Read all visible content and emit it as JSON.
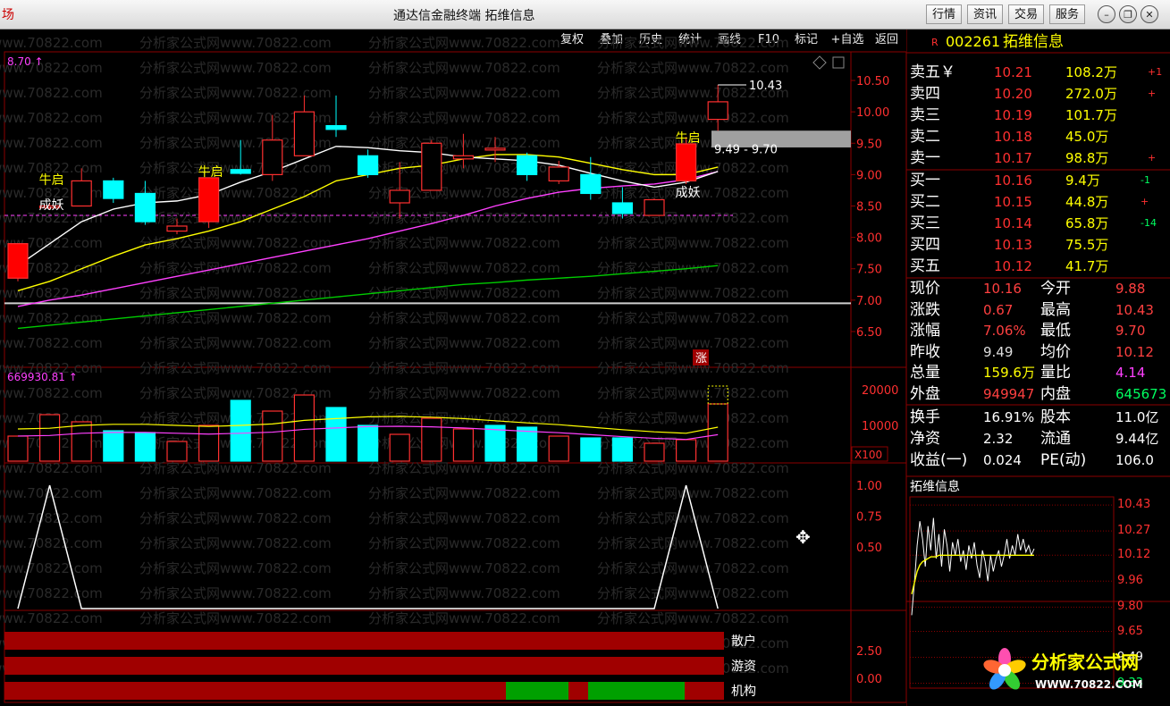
{
  "window": {
    "title": "通达信金融终端  拓维信息",
    "left_tag": "场",
    "top_buttons": [
      "行情",
      "资讯",
      "交易",
      "服务"
    ],
    "window_controls": [
      "minimize-icon",
      "restore-icon",
      "close-icon"
    ]
  },
  "toolbar": {
    "items": [
      "复权",
      "叠加",
      "历史",
      "统计",
      "画线",
      "F10",
      "标记",
      "+自选",
      "返回"
    ]
  },
  "watermark": "分析家公式网www.70822.com",
  "main_chart": {
    "indicator_label": "8.70",
    "price_axis": [
      "10.50",
      "10.00",
      "9.50",
      "9.00",
      "8.50",
      "8.00",
      "7.50",
      "7.00",
      "6.50"
    ],
    "high_label": "10.43",
    "range_label": "9.49 - 9.70",
    "signal_labels": [
      {
        "text": "牛启",
        "color": "#ffff00"
      },
      {
        "text": "成妖",
        "color": "#ffffff"
      },
      {
        "text": "牛启",
        "color": "#ffff00"
      },
      {
        "text": "牛启",
        "color": "#ffff00"
      },
      {
        "text": "成妖",
        "color": "#ffffff"
      }
    ],
    "zhang_tag": "涨",
    "candles": [
      {
        "o": 7.35,
        "c": 7.9,
        "h": 7.9,
        "l": 7.3
      },
      {
        "o": 8.5,
        "c": 8.5,
        "h": 8.55,
        "l": 8.45
      },
      {
        "o": 8.5,
        "c": 8.9,
        "h": 9.1,
        "l": 8.5
      },
      {
        "o": 8.9,
        "c": 8.62,
        "h": 8.95,
        "l": 8.55
      },
      {
        "o": 8.7,
        "c": 8.25,
        "h": 8.9,
        "l": 8.2
      },
      {
        "o": 8.1,
        "c": 8.18,
        "h": 8.3,
        "l": 8.05
      },
      {
        "o": 8.25,
        "c": 8.95,
        "h": 8.95,
        "l": 8.15
      },
      {
        "o": 9.08,
        "c": 9.02,
        "h": 9.55,
        "l": 9.0
      },
      {
        "o": 9.0,
        "c": 9.55,
        "h": 9.95,
        "l": 8.9
      },
      {
        "o": 9.3,
        "c": 10.0,
        "h": 10.26,
        "l": 9.3
      },
      {
        "o": 9.78,
        "c": 9.72,
        "h": 10.26,
        "l": 9.6
      },
      {
        "o": 9.3,
        "c": 9.0,
        "h": 9.4,
        "l": 8.95
      },
      {
        "o": 8.55,
        "c": 8.75,
        "h": 9.2,
        "l": 8.3
      },
      {
        "o": 8.75,
        "c": 9.5,
        "h": 9.55,
        "l": 8.75
      },
      {
        "o": 9.25,
        "c": 9.3,
        "h": 9.65,
        "l": 9.1
      },
      {
        "o": 9.42,
        "c": 9.42,
        "h": 9.6,
        "l": 9.2
      },
      {
        "o": 9.3,
        "c": 9.0,
        "h": 9.35,
        "l": 8.9
      },
      {
        "o": 8.9,
        "c": 9.12,
        "h": 9.22,
        "l": 8.85
      },
      {
        "o": 9.0,
        "c": 8.7,
        "h": 9.28,
        "l": 8.6
      },
      {
        "o": 8.55,
        "c": 8.38,
        "h": 8.8,
        "l": 8.3
      },
      {
        "o": 8.35,
        "c": 8.6,
        "h": 8.62,
        "l": 8.35
      },
      {
        "o": 8.9,
        "c": 9.49,
        "h": 9.6,
        "l": 8.85
      },
      {
        "o": 9.88,
        "c": 10.16,
        "h": 10.43,
        "l": 9.7
      }
    ],
    "ma5": [
      7.55,
      7.9,
      8.25,
      8.45,
      8.55,
      8.58,
      8.68,
      8.88,
      9.05,
      9.25,
      9.45,
      9.43,
      9.38,
      9.35,
      9.28,
      9.25,
      9.22,
      9.15,
      9.02,
      8.9,
      8.8,
      8.88,
      9.05
    ],
    "ma10": [
      7.15,
      7.3,
      7.5,
      7.7,
      7.88,
      7.98,
      8.1,
      8.25,
      8.45,
      8.65,
      8.9,
      9.0,
      9.1,
      9.15,
      9.25,
      9.32,
      9.32,
      9.28,
      9.18,
      9.08,
      9.0,
      9.0,
      9.12
    ],
    "ma20": [
      6.9,
      7.0,
      7.08,
      7.18,
      7.28,
      7.38,
      7.48,
      7.58,
      7.68,
      7.78,
      7.88,
      7.98,
      8.1,
      8.22,
      8.35,
      8.5,
      8.62,
      8.72,
      8.78,
      8.82,
      8.85,
      8.92,
      9.05
    ],
    "ma60": [
      6.55,
      6.6,
      6.65,
      6.7,
      6.75,
      6.8,
      6.85,
      6.9,
      6.95,
      7.0,
      7.05,
      7.1,
      7.15,
      7.2,
      7.25,
      7.28,
      7.32,
      7.35,
      7.38,
      7.42,
      7.46,
      7.5,
      7.55
    ]
  },
  "volume": {
    "label": "669930.81",
    "axis": [
      "20000",
      "10000",
      "X100"
    ],
    "bars": [
      {
        "v": 7000,
        "up": true
      },
      {
        "v": 13000,
        "up": true
      },
      {
        "v": 11000,
        "up": true
      },
      {
        "v": 8500,
        "up": false
      },
      {
        "v": 8000,
        "up": false
      },
      {
        "v": 5500,
        "up": true
      },
      {
        "v": 10000,
        "up": true
      },
      {
        "v": 17000,
        "up": false
      },
      {
        "v": 14000,
        "up": true
      },
      {
        "v": 18500,
        "up": true
      },
      {
        "v": 15000,
        "up": false
      },
      {
        "v": 10000,
        "up": false
      },
      {
        "v": 7500,
        "up": true
      },
      {
        "v": 12000,
        "up": true
      },
      {
        "v": 9000,
        "up": true
      },
      {
        "v": 10000,
        "up": false
      },
      {
        "v": 9500,
        "up": false
      },
      {
        "v": 7000,
        "up": true
      },
      {
        "v": 6500,
        "up": false
      },
      {
        "v": 6500,
        "up": false
      },
      {
        "v": 5000,
        "up": true
      },
      {
        "v": 6000,
        "up": true
      },
      {
        "v": 16000,
        "up": true
      }
    ],
    "ma": [
      9000,
      9200,
      10000,
      10300,
      10300,
      10000,
      9700,
      10000,
      10400,
      11400,
      11900,
      12400,
      12500,
      12300,
      11900,
      11300,
      10700,
      10200,
      9500,
      8800,
      8200,
      7800,
      9500
    ]
  },
  "osc": {
    "axis": [
      "1.00",
      "0.75",
      "0.50"
    ],
    "values": [
      0,
      1,
      0,
      0,
      0,
      0,
      0,
      0,
      0,
      0,
      0,
      0,
      0,
      0,
      0,
      0,
      0,
      0,
      0,
      0,
      0,
      1,
      0
    ]
  },
  "strips": {
    "axis": [
      "2.50",
      "0.00"
    ],
    "labels": [
      "散户",
      "游资",
      "机构"
    ]
  },
  "quote": {
    "code": "002261",
    "name": "拓维信息",
    "r_mark": "R",
    "sell": [
      {
        "label": "卖五",
        "price": "10.21",
        "vol": "108.2万",
        "chg": "+1"
      },
      {
        "label": "卖四",
        "price": "10.20",
        "vol": "272.0万",
        "chg": "+"
      },
      {
        "label": "卖三",
        "price": "10.19",
        "vol": "101.7万",
        "chg": ""
      },
      {
        "label": "卖二",
        "price": "10.18",
        "vol": "45.0万",
        "chg": ""
      },
      {
        "label": "卖一",
        "price": "10.17",
        "vol": "98.8万",
        "chg": "+"
      }
    ],
    "buy": [
      {
        "label": "买一",
        "price": "10.16",
        "vol": "9.4万",
        "chg": "-1"
      },
      {
        "label": "买二",
        "price": "10.15",
        "vol": "44.8万",
        "chg": "+"
      },
      {
        "label": "买三",
        "price": "10.14",
        "vol": "65.8万",
        "chg": "-14"
      },
      {
        "label": "买四",
        "price": "10.13",
        "vol": "75.5万",
        "chg": ""
      },
      {
        "label": "买五",
        "price": "10.12",
        "vol": "41.7万",
        "chg": ""
      }
    ],
    "stats": [
      {
        "l1": "现价",
        "v1": "10.16",
        "c1": "#ff4040",
        "l2": "今开",
        "v2": "9.88",
        "c2": "#ff4040"
      },
      {
        "l1": "涨跌",
        "v1": "0.67",
        "c1": "#ff4040",
        "l2": "最高",
        "v2": "10.43",
        "c2": "#ff4040"
      },
      {
        "l1": "涨幅",
        "v1": "7.06%",
        "c1": "#ff4040",
        "l2": "最低",
        "v2": "9.70",
        "c2": "#ff4040"
      },
      {
        "l1": "昨收",
        "v1": "9.49",
        "c1": "#dddddd",
        "l2": "均价",
        "v2": "10.12",
        "c2": "#ff4040"
      },
      {
        "l1": "总量",
        "v1": "159.6万",
        "c1": "#ffff00",
        "l2": "量比",
        "v2": "4.14",
        "c2": "#ff40ff"
      },
      {
        "l1": "外盘",
        "v1": "949947",
        "c1": "#ff4040",
        "l2": "内盘",
        "v2": "645673",
        "c2": "#00ff60"
      }
    ],
    "stats2": [
      {
        "l1": "换手",
        "v1": "16.91%",
        "l2": "股本",
        "v2": "11.0亿"
      },
      {
        "l1": "净资",
        "v1": "2.32",
        "l2": "流通",
        "v2": "9.44亿"
      },
      {
        "l1": "收益(一)",
        "v1": "0.024",
        "l2": "PE(动)",
        "v2": "106.0"
      }
    ]
  },
  "mini_chart": {
    "title": "拓维信息",
    "axis": [
      "10.43",
      "10.27",
      "10.12",
      "9.96",
      "9.80",
      "9.65",
      "9.49",
      "9.33"
    ],
    "prices": [
      9.75,
      9.95,
      10.18,
      10.33,
      10.22,
      10.05,
      10.3,
      10.15,
      10.35,
      10.1,
      10.25,
      10.05,
      10.28,
      10.18,
      10.02,
      10.2,
      10.12,
      10.22,
      10.08,
      10.15,
      10.03,
      10.18,
      10.1,
      10.2,
      10.06,
      9.98,
      10.15,
      10.08,
      9.96,
      10.12,
      10.02,
      10.1,
      10.15,
      10.05,
      10.12,
      10.22,
      10.1,
      10.18,
      10.12,
      10.25,
      10.15,
      10.22,
      10.14,
      10.18,
      10.12,
      10.16
    ],
    "avg": [
      9.88,
      9.95,
      10.02,
      10.06,
      10.08,
      10.09,
      10.1,
      10.11,
      10.11,
      10.11,
      10.12,
      10.12,
      10.12,
      10.12,
      10.12,
      10.12,
      10.12,
      10.12,
      10.12,
      10.12,
      10.12,
      10.12,
      10.12,
      10.12,
      10.12,
      10.12,
      10.12,
      10.12,
      10.12,
      10.12,
      10.12,
      10.12,
      10.12,
      10.12,
      10.12,
      10.12,
      10.12,
      10.12,
      10.12,
      10.12,
      10.12,
      10.12,
      10.12,
      10.12,
      10.12,
      10.12
    ]
  },
  "logo": {
    "text": "分析家公式网",
    "url_text": "WWW.70822.COM"
  }
}
